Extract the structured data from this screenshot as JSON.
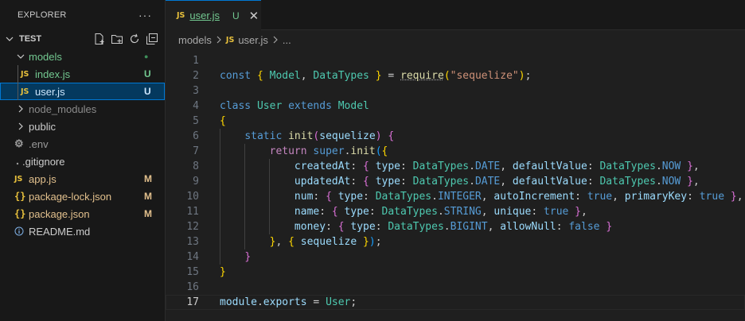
{
  "explorer": {
    "title": "EXPLORER",
    "more": "···",
    "root": "TEST",
    "tree": [
      {
        "label": "models",
        "type": "folder-open",
        "status": "●",
        "color": "#73c991",
        "status_color": "#3e8f5a"
      },
      {
        "label": "index.js",
        "type": "js",
        "status": "U",
        "color": "#73c991",
        "status_color": "#73c991"
      },
      {
        "label": "user.js",
        "type": "js",
        "status": "U",
        "color": "#73c991",
        "status_color": "#73c991"
      },
      {
        "label": "node_modules",
        "type": "folder",
        "status": "",
        "color": "#8b8b8b",
        "status_color": ""
      },
      {
        "label": "public",
        "type": "folder",
        "status": "",
        "color": "#cccccc",
        "status_color": ""
      },
      {
        "label": ".env",
        "type": "env",
        "status": "",
        "color": "#9a9a9a",
        "status_color": ""
      },
      {
        "label": ".gitignore",
        "type": "git",
        "status": "",
        "color": "#cccccc",
        "status_color": ""
      },
      {
        "label": "app.js",
        "type": "js",
        "status": "M",
        "color": "#e2c08d",
        "status_color": "#e2c08d"
      },
      {
        "label": "package-lock.json",
        "type": "json",
        "status": "M",
        "color": "#e2c08d",
        "status_color": "#e2c08d"
      },
      {
        "label": "package.json",
        "type": "json",
        "status": "M",
        "color": "#e2c08d",
        "status_color": "#e2c08d"
      },
      {
        "label": "README.md",
        "type": "md",
        "status": "",
        "color": "#cccccc",
        "status_color": ""
      }
    ]
  },
  "tab": {
    "icon": "JS",
    "name": "user.js",
    "badge": "U",
    "close": "✕"
  },
  "breadcrumb": {
    "folder": "models",
    "icon": "JS",
    "file": "user.js",
    "rest": "..."
  },
  "editor": {
    "current_line": 17,
    "lines": [
      [],
      [
        [
          "const ",
          "kw"
        ],
        [
          "{ ",
          "br1"
        ],
        [
          "Model",
          "cls"
        ],
        [
          ", ",
          "pun"
        ],
        [
          "DataTypes",
          "cls"
        ],
        [
          " }",
          "br1"
        ],
        [
          " = ",
          "pun"
        ],
        [
          "require",
          "fn uline"
        ],
        [
          "(",
          "br1"
        ],
        [
          "\"sequelize\"",
          "str"
        ],
        [
          ")",
          "br1"
        ],
        [
          ";",
          "pun"
        ]
      ],
      [],
      [
        [
          "class ",
          "kw"
        ],
        [
          "User ",
          "cls"
        ],
        [
          "extends ",
          "kw"
        ],
        [
          "Model",
          "cls"
        ]
      ],
      [
        [
          "{",
          "br1"
        ]
      ],
      [
        [
          "    ",
          "pun"
        ],
        [
          "static ",
          "kw"
        ],
        [
          "init",
          "fn"
        ],
        [
          "(",
          "br2"
        ],
        [
          "sequelize",
          "var"
        ],
        [
          ") ",
          "br2"
        ],
        [
          "{",
          "br2"
        ]
      ],
      [
        [
          "        ",
          "pun"
        ],
        [
          "return ",
          "cf"
        ],
        [
          "super",
          "kw"
        ],
        [
          ".",
          "pun"
        ],
        [
          "init",
          "fn"
        ],
        [
          "(",
          "br3"
        ],
        [
          "{",
          "br1"
        ]
      ],
      [
        [
          "            ",
          "pun"
        ],
        [
          "createdAt",
          "var"
        ],
        [
          ": ",
          "pun"
        ],
        [
          "{ ",
          "br2"
        ],
        [
          "type",
          "var"
        ],
        [
          ": ",
          "pun"
        ],
        [
          "DataTypes",
          "cls"
        ],
        [
          ".",
          "pun"
        ],
        [
          "DATE",
          "kw"
        ],
        [
          ", ",
          "pun"
        ],
        [
          "defaultValue",
          "var"
        ],
        [
          ": ",
          "pun"
        ],
        [
          "DataTypes",
          "cls"
        ],
        [
          ".",
          "pun"
        ],
        [
          "NOW",
          "kw"
        ],
        [
          " }",
          "br2"
        ],
        [
          ",",
          "pun"
        ]
      ],
      [
        [
          "            ",
          "pun"
        ],
        [
          "updatedAt",
          "var"
        ],
        [
          ": ",
          "pun"
        ],
        [
          "{ ",
          "br2"
        ],
        [
          "type",
          "var"
        ],
        [
          ": ",
          "pun"
        ],
        [
          "DataTypes",
          "cls"
        ],
        [
          ".",
          "pun"
        ],
        [
          "DATE",
          "kw"
        ],
        [
          ", ",
          "pun"
        ],
        [
          "defaultValue",
          "var"
        ],
        [
          ": ",
          "pun"
        ],
        [
          "DataTypes",
          "cls"
        ],
        [
          ".",
          "pun"
        ],
        [
          "NOW",
          "kw"
        ],
        [
          " }",
          "br2"
        ],
        [
          ",",
          "pun"
        ]
      ],
      [
        [
          "            ",
          "pun"
        ],
        [
          "num",
          "var"
        ],
        [
          ": ",
          "pun"
        ],
        [
          "{ ",
          "br2"
        ],
        [
          "type",
          "var"
        ],
        [
          ": ",
          "pun"
        ],
        [
          "DataTypes",
          "cls"
        ],
        [
          ".",
          "pun"
        ],
        [
          "INTEGER",
          "kw"
        ],
        [
          ", ",
          "pun"
        ],
        [
          "autoIncrement",
          "var"
        ],
        [
          ": ",
          "pun"
        ],
        [
          "true",
          "kw"
        ],
        [
          ", ",
          "pun"
        ],
        [
          "primaryKey",
          "var"
        ],
        [
          ": ",
          "pun"
        ],
        [
          "true",
          "kw"
        ],
        [
          " }",
          "br2"
        ],
        [
          ",",
          "pun"
        ]
      ],
      [
        [
          "            ",
          "pun"
        ],
        [
          "name",
          "var"
        ],
        [
          ": ",
          "pun"
        ],
        [
          "{ ",
          "br2"
        ],
        [
          "type",
          "var"
        ],
        [
          ": ",
          "pun"
        ],
        [
          "DataTypes",
          "cls"
        ],
        [
          ".",
          "pun"
        ],
        [
          "STRING",
          "kw"
        ],
        [
          ", ",
          "pun"
        ],
        [
          "unique",
          "var"
        ],
        [
          ": ",
          "pun"
        ],
        [
          "true",
          "kw"
        ],
        [
          " }",
          "br2"
        ],
        [
          ",",
          "pun"
        ]
      ],
      [
        [
          "            ",
          "pun"
        ],
        [
          "money",
          "var"
        ],
        [
          ": ",
          "pun"
        ],
        [
          "{ ",
          "br2"
        ],
        [
          "type",
          "var"
        ],
        [
          ": ",
          "pun"
        ],
        [
          "DataTypes",
          "cls"
        ],
        [
          ".",
          "pun"
        ],
        [
          "BIGINT",
          "kw"
        ],
        [
          ", ",
          "pun"
        ],
        [
          "allowNull",
          "var"
        ],
        [
          ": ",
          "pun"
        ],
        [
          "false",
          "kw"
        ],
        [
          " }",
          "br2"
        ]
      ],
      [
        [
          "        ",
          "pun"
        ],
        [
          "}",
          "br1"
        ],
        [
          ", ",
          "pun"
        ],
        [
          "{ ",
          "br1"
        ],
        [
          "sequelize",
          "var"
        ],
        [
          " }",
          "br1"
        ],
        [
          ")",
          "br3"
        ],
        [
          ";",
          "pun"
        ]
      ],
      [
        [
          "    ",
          "pun"
        ],
        [
          "}",
          "br2"
        ]
      ],
      [
        [
          "}",
          "br1"
        ]
      ],
      [],
      [
        [
          "module",
          "var"
        ],
        [
          ".",
          "pun"
        ],
        [
          "exports",
          "var"
        ],
        [
          " = ",
          "pun"
        ],
        [
          "User",
          "cls"
        ],
        [
          ";",
          "pun"
        ]
      ]
    ]
  }
}
